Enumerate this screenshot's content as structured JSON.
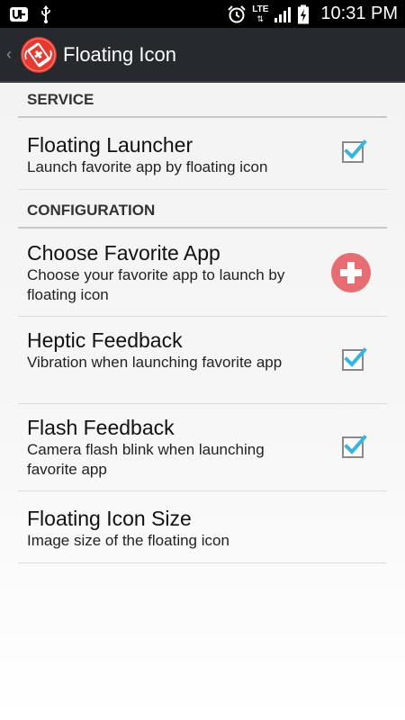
{
  "status_bar": {
    "network_label": "LTE",
    "time": "10:31 PM"
  },
  "action_bar": {
    "title": "Floating Icon"
  },
  "categories": [
    {
      "header": "SERVICE",
      "items": [
        {
          "title": "Floating Launcher",
          "summary": "Launch favorite app by floating icon",
          "widget": "checkbox",
          "checked": true
        }
      ]
    },
    {
      "header": "CONFIGURATION",
      "items": [
        {
          "title": "Choose Favorite App",
          "summary": "Choose your favorite app to launch by floating icon",
          "widget": "add-button",
          "color": "#e86d72"
        },
        {
          "title": "Heptic Feedback",
          "summary": "Vibration when launching favorite app",
          "widget": "checkbox",
          "checked": true
        },
        {
          "title": "Flash Feedback",
          "summary": "Camera flash blink when launching favorite app",
          "widget": "checkbox",
          "checked": true
        },
        {
          "title": "Floating Icon Size",
          "summary": "Image size of the floating icon",
          "widget": "none"
        }
      ]
    }
  ],
  "colors": {
    "action_bar": "#262a2f",
    "checkmark": "#33b5e5",
    "add_button": "#e86d72",
    "app_icon": "#e8392f"
  }
}
